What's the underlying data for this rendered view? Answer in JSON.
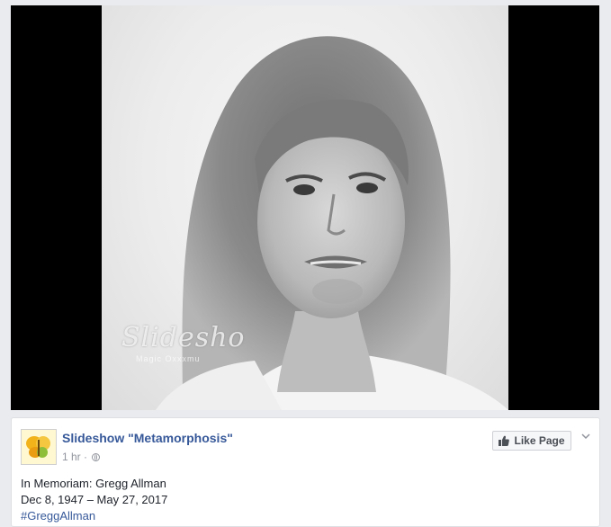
{
  "video": {
    "watermark_text": "Slidesho",
    "watermark_sub": "Magic Oxxxmu"
  },
  "post": {
    "page_name": "Slideshow \"Metamorphosis\"",
    "time": "1 hr",
    "separator": "·",
    "privacy_icon": "globe-icon",
    "like_page_label": "Like Page",
    "menu_icon": "chevron-down-icon",
    "text_line1": "In Memoriam: Gregg Allman",
    "text_line2": "Dec 8, 1947 – May 27, 2017",
    "hashtag": "#GreggAllman"
  },
  "colors": {
    "link": "#365899",
    "meta": "#90949c",
    "frame": "#000000"
  }
}
